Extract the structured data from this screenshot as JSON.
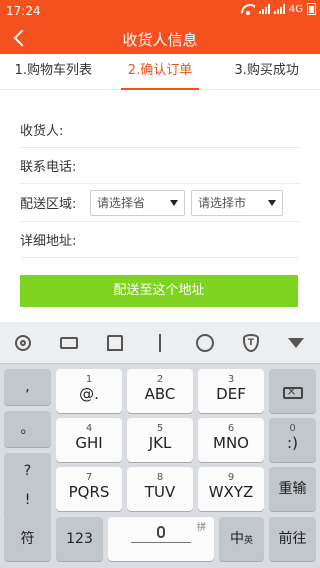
{
  "status_bar": {
    "time": "17:24",
    "network": "4G"
  },
  "header": {
    "title": "收货人信息",
    "bg_color": "#f4511e"
  },
  "steps": [
    {
      "label": "1.购物车列表",
      "active": false
    },
    {
      "label": "2.确认订单",
      "active": true
    },
    {
      "label": "3.购买成功",
      "active": false
    }
  ],
  "form": {
    "recipient_label": "收货人:",
    "phone_label": "联系电话:",
    "region_label": "配送区域:",
    "province_placeholder": "请选择省",
    "city_placeholder": "请选择市",
    "address_label": "详细地址:"
  },
  "submit": {
    "label": "配送至这个地址",
    "color": "#7ed321"
  },
  "keyboard": {
    "toolbar_icons": [
      "gear-icon",
      "keyboard-icon",
      "shirt-icon",
      "cursor-icon",
      "smile-icon",
      "shield-icon",
      "collapse-icon"
    ],
    "shield_letter": "T",
    "left_column": [
      ",",
      "。",
      "?",
      "!"
    ],
    "keys": [
      {
        "sub": "1",
        "main": "@."
      },
      {
        "sub": "2",
        "main": "ABC"
      },
      {
        "sub": "3",
        "main": "DEF"
      },
      {
        "sub": "4",
        "main": "GHI"
      },
      {
        "sub": "5",
        "main": "JKL"
      },
      {
        "sub": "6",
        "main": "MNO"
      },
      {
        "sub": "7",
        "main": "PQRS"
      },
      {
        "sub": "8",
        "main": "TUV"
      },
      {
        "sub": "9",
        "main": "WXYZ"
      }
    ],
    "zero_key": {
      "sub": "0",
      "main": ":)"
    },
    "reinput": "重输",
    "symbol": "符",
    "numbers": "123",
    "space_hint": "拼",
    "cn_en": "中",
    "cn_en_sub": "英",
    "enter": "前往"
  }
}
